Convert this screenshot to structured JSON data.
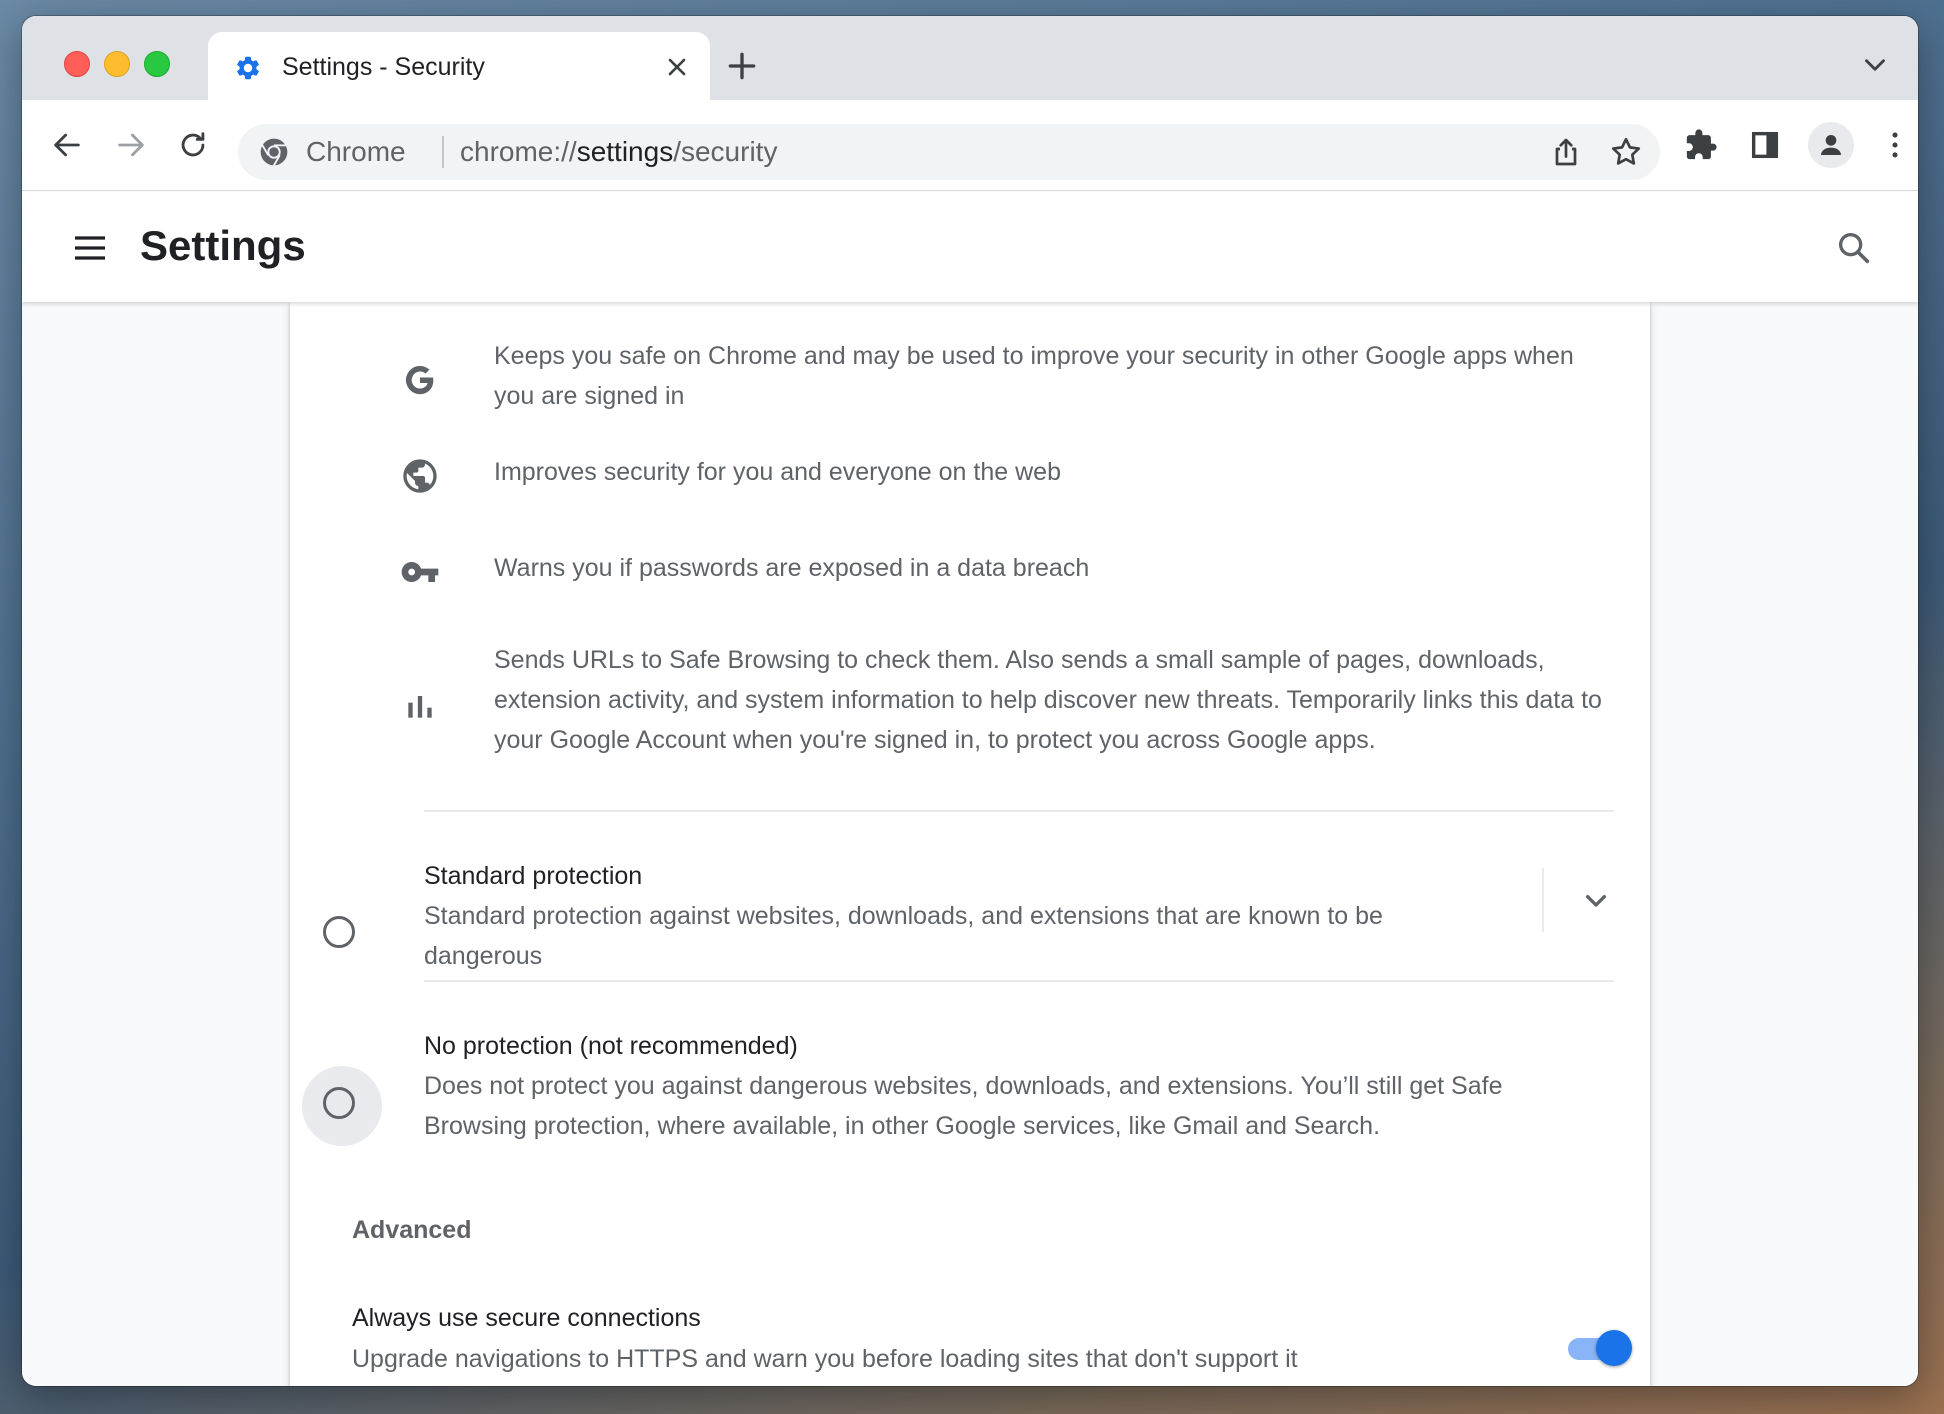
{
  "colors": {
    "accent": "#1a73e8",
    "text_primary": "#202124",
    "text_secondary": "#5f6368",
    "toggle_track": "#8ab4f8"
  },
  "tab": {
    "title": "Settings - Security",
    "icon": "gear-icon"
  },
  "omnibox": {
    "chip": "Chrome",
    "url_scheme": "chrome://",
    "url_host": "settings",
    "url_path": "/security"
  },
  "header": {
    "title": "Settings"
  },
  "features": [
    {
      "icon": "google-g-icon",
      "text": "Keeps you safe on Chrome and may be used to improve your security in other Google apps when you are signed in"
    },
    {
      "icon": "globe-icon",
      "text": "Improves security for you and everyone on the web"
    },
    {
      "icon": "key-icon",
      "text": "Warns you if passwords are exposed in a data breach"
    },
    {
      "icon": "bar-chart-icon",
      "text": "Sends URLs to Safe Browsing to check them. Also sends a small sample of pages, downloads, extension activity, and system information to help discover new threats. Temporarily links this data to your Google Account when you're signed in, to protect you across Google apps."
    }
  ],
  "options": [
    {
      "title": "Standard protection",
      "description": "Standard protection against websites, downloads, and extensions that are known to be dangerous",
      "selected": false
    },
    {
      "title": "No protection (not recommended)",
      "description": "Does not protect you against dangerous websites, downloads, and extensions. You’ll still get Safe Browsing protection, where available, in other Google services, like Gmail and Search.",
      "selected": false
    }
  ],
  "advanced": {
    "heading": "Advanced",
    "secure_connections": {
      "title": "Always use secure connections",
      "description": "Upgrade navigations to HTTPS and warn you before loading sites that don't support it",
      "enabled": true
    }
  }
}
